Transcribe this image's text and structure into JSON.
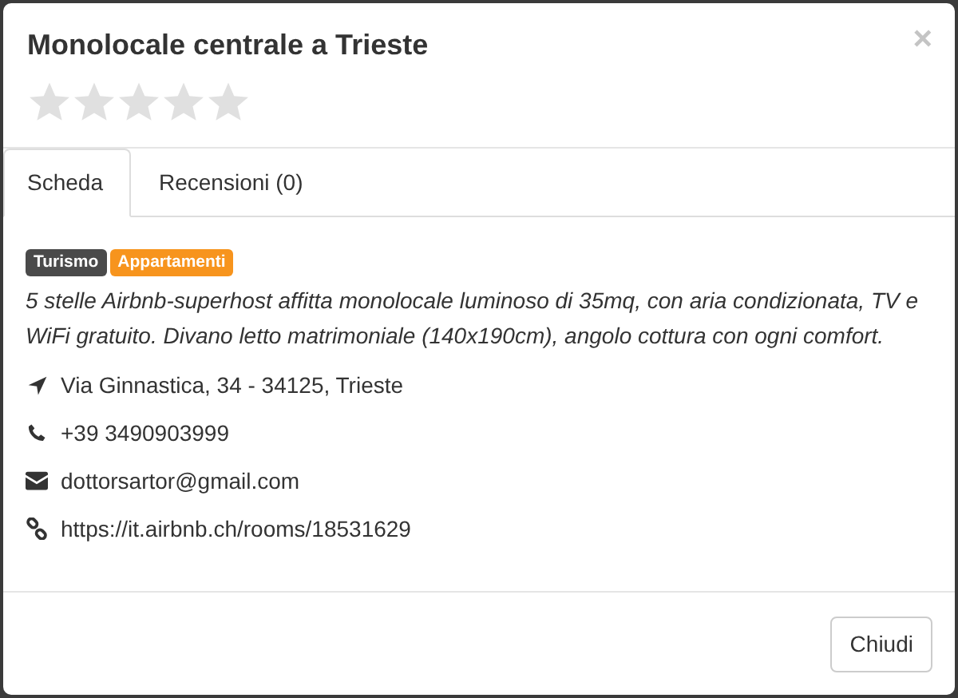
{
  "dialog": {
    "title": "Monolocale centrale a Trieste",
    "stars": 0,
    "close": "×"
  },
  "tabs": [
    {
      "label": "Scheda",
      "selected": true
    },
    {
      "label": "Recensioni (0)",
      "selected": false
    }
  ],
  "tags": [
    {
      "label": "Turismo",
      "color": "#4a4a4a"
    },
    {
      "label": "Appartamenti",
      "color": "#f7941d"
    }
  ],
  "description": "5 stelle Airbnb-superhost affitta monolocale luminoso di 35mq, con aria condizionata, TV e WiFi gratuito. Divano letto matrimoniale (140x190cm), angolo cottura con ogni comfort.",
  "details": [
    {
      "kind": "address",
      "text": "Via Ginnastica, 34 - 34125, Trieste"
    },
    {
      "kind": "phone",
      "text": "+39 3490903999"
    },
    {
      "kind": "email",
      "text": "dottorsartor@gmail.com"
    },
    {
      "kind": "website",
      "text": "https://it.airbnb.ch/rooms/18531629"
    }
  ],
  "buttons": [
    "Chiudi"
  ]
}
